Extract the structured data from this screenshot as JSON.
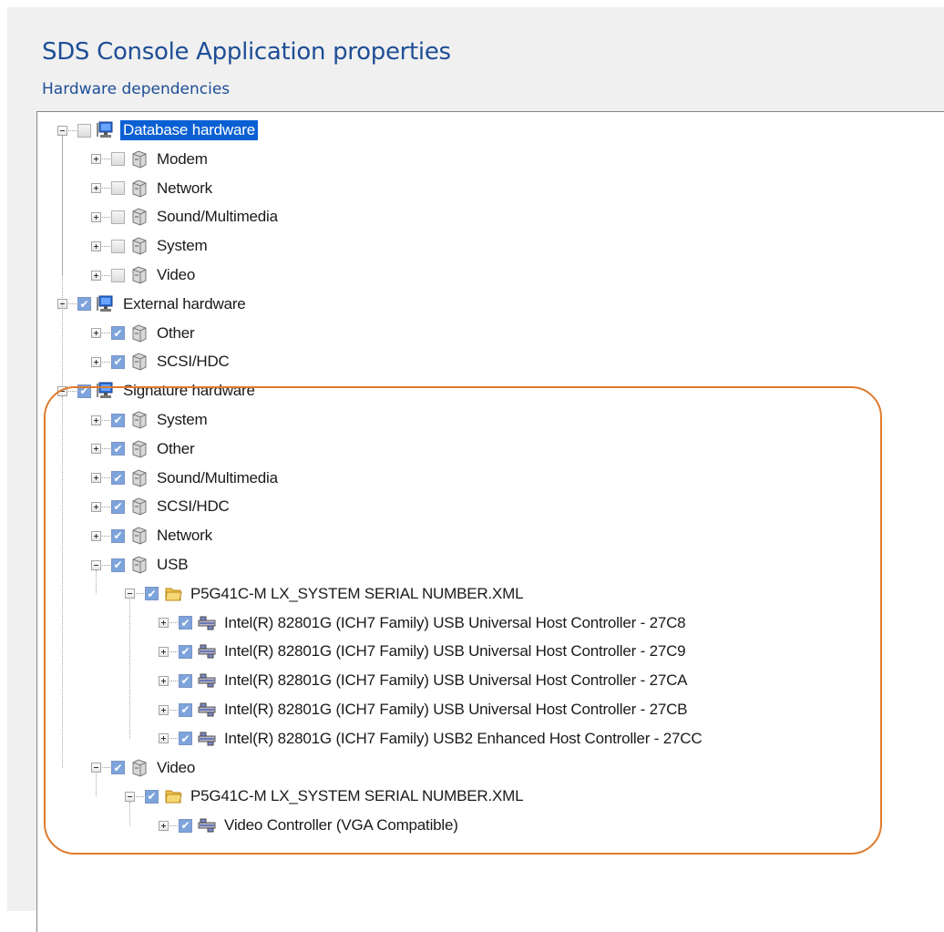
{
  "dialog": {
    "title": "SDS Console Application properties",
    "subtitle": "Hardware dependencies"
  },
  "colors": {
    "title": "#1e4e96",
    "selection": "#0a5fd3",
    "checkbox_checked": "#7ea4dc",
    "highlight_outline": "#e07a2c"
  },
  "tree": {
    "rows": [
      {
        "label": "Database hardware",
        "level": 0,
        "expander": "minus",
        "checked": false,
        "icon": "computer-icon",
        "selected": true
      },
      {
        "label": "Modem",
        "level": 1,
        "expander": "plus",
        "checked": false,
        "icon": "device-icon"
      },
      {
        "label": "Network",
        "level": 1,
        "expander": "plus",
        "checked": false,
        "icon": "device-icon"
      },
      {
        "label": "Sound/Multimedia",
        "level": 1,
        "expander": "plus",
        "checked": false,
        "icon": "device-icon"
      },
      {
        "label": "System",
        "level": 1,
        "expander": "plus",
        "checked": false,
        "icon": "device-icon"
      },
      {
        "label": "Video",
        "level": 1,
        "expander": "plus",
        "checked": false,
        "icon": "device-icon"
      },
      {
        "label": "External hardware",
        "level": 0,
        "expander": "minus",
        "checked": true,
        "icon": "computer-icon"
      },
      {
        "label": "Other",
        "level": 1,
        "expander": "plus",
        "checked": true,
        "icon": "device-icon"
      },
      {
        "label": "SCSI/HDC",
        "level": 1,
        "expander": "plus",
        "checked": true,
        "icon": "device-icon"
      },
      {
        "label": "Signature hardware",
        "level": 0,
        "expander": "minus",
        "checked": true,
        "icon": "computer-icon"
      },
      {
        "label": "System",
        "level": 1,
        "expander": "plus",
        "checked": true,
        "icon": "device-icon"
      },
      {
        "label": "Other",
        "level": 1,
        "expander": "plus",
        "checked": true,
        "icon": "device-icon"
      },
      {
        "label": "Sound/Multimedia",
        "level": 1,
        "expander": "plus",
        "checked": true,
        "icon": "device-icon"
      },
      {
        "label": "SCSI/HDC",
        "level": 1,
        "expander": "plus",
        "checked": true,
        "icon": "device-icon"
      },
      {
        "label": "Network",
        "level": 1,
        "expander": "plus",
        "checked": true,
        "icon": "device-icon"
      },
      {
        "label": "USB",
        "level": 1,
        "expander": "minus",
        "checked": true,
        "icon": "device-icon"
      },
      {
        "label": "P5G41C-M LX_SYSTEM SERIAL NUMBER.XML",
        "level": 2,
        "expander": "minus",
        "checked": true,
        "icon": "folder-icon"
      },
      {
        "label": "Intel(R) 82801G (ICH7 Family) USB Universal Host Controller - 27C8",
        "level": 3,
        "expander": "plus",
        "checked": true,
        "icon": "controller-icon"
      },
      {
        "label": "Intel(R) 82801G (ICH7 Family) USB Universal Host Controller - 27C9",
        "level": 3,
        "expander": "plus",
        "checked": true,
        "icon": "controller-icon"
      },
      {
        "label": "Intel(R) 82801G (ICH7 Family) USB Universal Host Controller - 27CA",
        "level": 3,
        "expander": "plus",
        "checked": true,
        "icon": "controller-icon"
      },
      {
        "label": "Intel(R) 82801G (ICH7 Family) USB Universal Host Controller - 27CB",
        "level": 3,
        "expander": "plus",
        "checked": true,
        "icon": "controller-icon"
      },
      {
        "label": "Intel(R) 82801G (ICH7 Family) USB2 Enhanced Host Controller - 27CC",
        "level": 3,
        "expander": "plus",
        "checked": true,
        "icon": "controller-icon"
      },
      {
        "label": "Video",
        "level": 1,
        "expander": "minus",
        "checked": true,
        "icon": "device-icon"
      },
      {
        "label": "P5G41C-M LX_SYSTEM SERIAL NUMBER.XML",
        "level": 2,
        "expander": "minus",
        "checked": true,
        "icon": "folder-icon"
      },
      {
        "label": "Video Controller (VGA Compatible)",
        "level": 3,
        "expander": "plus",
        "checked": true,
        "icon": "controller-icon"
      }
    ]
  }
}
